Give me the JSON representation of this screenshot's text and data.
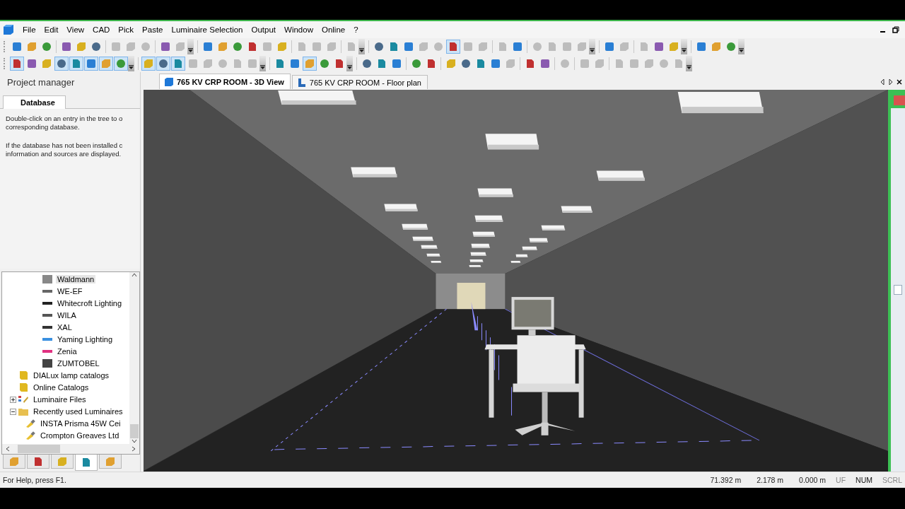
{
  "menu": [
    {
      "label": "File"
    },
    {
      "label": "Edit"
    },
    {
      "label": "View"
    },
    {
      "label": "CAD"
    },
    {
      "label": "Pick"
    },
    {
      "label": "Paste"
    },
    {
      "label": "Luminaire Selection"
    },
    {
      "label": "Output"
    },
    {
      "label": "Window"
    },
    {
      "label": "Online"
    },
    {
      "label": "?"
    }
  ],
  "toolbars": [
    [
      {
        "kind": "button",
        "pressed": false,
        "disabled": false
      },
      {
        "kind": "button",
        "pressed": false,
        "disabled": false
      },
      {
        "kind": "button",
        "pressed": false,
        "disabled": false
      },
      {
        "kind": "separator"
      },
      {
        "kind": "button",
        "pressed": false,
        "disabled": false
      },
      {
        "kind": "button",
        "pressed": false,
        "disabled": false
      },
      {
        "kind": "button",
        "pressed": false,
        "disabled": false
      },
      {
        "kind": "separator"
      },
      {
        "kind": "button",
        "pressed": false,
        "disabled": true
      },
      {
        "kind": "button",
        "pressed": false,
        "disabled": true
      },
      {
        "kind": "button",
        "pressed": false,
        "disabled": true
      },
      {
        "kind": "separator"
      },
      {
        "kind": "button",
        "pressed": false,
        "disabled": false
      },
      {
        "kind": "button",
        "pressed": false,
        "disabled": true
      },
      {
        "kind": "overflow"
      },
      {
        "kind": "separator"
      },
      {
        "kind": "button",
        "pressed": false,
        "disabled": false
      },
      {
        "kind": "button",
        "pressed": false,
        "disabled": false
      },
      {
        "kind": "button",
        "pressed": false,
        "disabled": false
      },
      {
        "kind": "button",
        "pressed": false,
        "disabled": false
      },
      {
        "kind": "button",
        "pressed": false,
        "disabled": true
      },
      {
        "kind": "button",
        "pressed": false,
        "disabled": false
      },
      {
        "kind": "separator"
      },
      {
        "kind": "button",
        "pressed": false,
        "disabled": true
      },
      {
        "kind": "button",
        "pressed": false,
        "disabled": true
      },
      {
        "kind": "button",
        "pressed": false,
        "disabled": true
      },
      {
        "kind": "separator"
      },
      {
        "kind": "button",
        "pressed": false,
        "disabled": true
      },
      {
        "kind": "overflow"
      },
      {
        "kind": "separator"
      },
      {
        "kind": "button",
        "pressed": false,
        "disabled": false
      },
      {
        "kind": "button",
        "pressed": false,
        "disabled": false
      },
      {
        "kind": "button",
        "pressed": false,
        "disabled": false
      },
      {
        "kind": "button",
        "pressed": false,
        "disabled": true
      },
      {
        "kind": "button",
        "pressed": false,
        "disabled": true
      },
      {
        "kind": "button",
        "pressed": true,
        "disabled": false
      },
      {
        "kind": "button",
        "pressed": false,
        "disabled": true
      },
      {
        "kind": "button",
        "pressed": false,
        "disabled": true
      },
      {
        "kind": "separator"
      },
      {
        "kind": "button",
        "pressed": false,
        "disabled": true
      },
      {
        "kind": "button",
        "pressed": false,
        "disabled": false
      },
      {
        "kind": "separator"
      },
      {
        "kind": "button",
        "pressed": false,
        "disabled": true
      },
      {
        "kind": "button",
        "pressed": false,
        "disabled": true
      },
      {
        "kind": "button",
        "pressed": false,
        "disabled": true
      },
      {
        "kind": "button",
        "pressed": false,
        "disabled": true
      },
      {
        "kind": "overflow"
      },
      {
        "kind": "separator"
      },
      {
        "kind": "button",
        "pressed": false,
        "disabled": false
      },
      {
        "kind": "button",
        "pressed": false,
        "disabled": true
      },
      {
        "kind": "separator"
      },
      {
        "kind": "button",
        "pressed": false,
        "disabled": true
      },
      {
        "kind": "button",
        "pressed": false,
        "disabled": false
      },
      {
        "kind": "button",
        "pressed": false,
        "disabled": false
      },
      {
        "kind": "overflow"
      },
      {
        "kind": "separator"
      },
      {
        "kind": "button",
        "pressed": false,
        "disabled": false
      },
      {
        "kind": "button",
        "pressed": false,
        "disabled": false
      },
      {
        "kind": "button",
        "pressed": false,
        "disabled": false
      },
      {
        "kind": "overflow"
      }
    ],
    [
      {
        "kind": "button",
        "pressed": true,
        "disabled": false
      },
      {
        "kind": "button",
        "pressed": false,
        "disabled": false
      },
      {
        "kind": "button",
        "pressed": false,
        "disabled": false
      },
      {
        "kind": "button",
        "pressed": true,
        "disabled": false
      },
      {
        "kind": "button",
        "pressed": true,
        "disabled": false
      },
      {
        "kind": "button",
        "pressed": true,
        "disabled": false
      },
      {
        "kind": "button",
        "pressed": true,
        "disabled": false
      },
      {
        "kind": "button",
        "pressed": true,
        "disabled": false
      },
      {
        "kind": "overflow"
      },
      {
        "kind": "separator"
      },
      {
        "kind": "button",
        "pressed": true,
        "disabled": false
      },
      {
        "kind": "button",
        "pressed": true,
        "disabled": false
      },
      {
        "kind": "button",
        "pressed": true,
        "disabled": false
      },
      {
        "kind": "button",
        "pressed": false,
        "disabled": true
      },
      {
        "kind": "button",
        "pressed": false,
        "disabled": true
      },
      {
        "kind": "button",
        "pressed": false,
        "disabled": true
      },
      {
        "kind": "button",
        "pressed": false,
        "disabled": true
      },
      {
        "kind": "button",
        "pressed": false,
        "disabled": true
      },
      {
        "kind": "overflow"
      },
      {
        "kind": "separator"
      },
      {
        "kind": "button",
        "pressed": false,
        "disabled": false
      },
      {
        "kind": "button",
        "pressed": false,
        "disabled": false
      },
      {
        "kind": "button",
        "pressed": true,
        "disabled": false
      },
      {
        "kind": "button",
        "pressed": false,
        "disabled": false
      },
      {
        "kind": "button",
        "pressed": false,
        "disabled": false
      },
      {
        "kind": "overflow"
      },
      {
        "kind": "separator"
      },
      {
        "kind": "button",
        "pressed": false,
        "disabled": false
      },
      {
        "kind": "button",
        "pressed": false,
        "disabled": false
      },
      {
        "kind": "button",
        "pressed": false,
        "disabled": false
      },
      {
        "kind": "separator"
      },
      {
        "kind": "button",
        "pressed": false,
        "disabled": false
      },
      {
        "kind": "button",
        "pressed": false,
        "disabled": false
      },
      {
        "kind": "separator"
      },
      {
        "kind": "button",
        "pressed": false,
        "disabled": false
      },
      {
        "kind": "button",
        "pressed": false,
        "disabled": false
      },
      {
        "kind": "button",
        "pressed": false,
        "disabled": false
      },
      {
        "kind": "button",
        "pressed": false,
        "disabled": false
      },
      {
        "kind": "button",
        "pressed": false,
        "disabled": true
      },
      {
        "kind": "separator"
      },
      {
        "kind": "button",
        "pressed": false,
        "disabled": false
      },
      {
        "kind": "button",
        "pressed": false,
        "disabled": false
      },
      {
        "kind": "separator"
      },
      {
        "kind": "button",
        "pressed": false,
        "disabled": true
      },
      {
        "kind": "separator"
      },
      {
        "kind": "button",
        "pressed": false,
        "disabled": true
      },
      {
        "kind": "button",
        "pressed": false,
        "disabled": true
      },
      {
        "kind": "separator"
      },
      {
        "kind": "button",
        "pressed": false,
        "disabled": true
      },
      {
        "kind": "button",
        "pressed": false,
        "disabled": true
      },
      {
        "kind": "button",
        "pressed": false,
        "disabled": true
      },
      {
        "kind": "button",
        "pressed": false,
        "disabled": true
      },
      {
        "kind": "button",
        "pressed": false,
        "disabled": true
      },
      {
        "kind": "overflow"
      }
    ]
  ],
  "project_manager": {
    "title": "Project manager",
    "tabs": [
      {
        "label": "Database",
        "selected": true
      }
    ],
    "help_paragraphs": [
      [
        "Double-click on an entry in the tree to o",
        "corresponding database."
      ],
      [
        "If the database has not been installed c",
        "information and sources are displayed."
      ]
    ],
    "tree": {
      "partial_group": [
        {
          "label": "Waldmann",
          "selected": true
        },
        {
          "label": "WE-EF",
          "selected": false
        },
        {
          "label": "Whitecroft Lighting",
          "selected": false
        },
        {
          "label": "WILA",
          "selected": false
        },
        {
          "label": "XAL",
          "selected": false
        },
        {
          "label": "Yaming Lighting",
          "selected": false
        },
        {
          "label": "Zenia",
          "selected": false
        },
        {
          "label": "ZUMTOBEL",
          "selected": false
        }
      ],
      "items": [
        {
          "label": "DIALux lamp catalogs",
          "kind": "book",
          "selected": false
        },
        {
          "label": "Online Catalogs",
          "kind": "book",
          "selected": false
        },
        {
          "label": "Luminaire Files",
          "kind": "files",
          "selected": false,
          "expanded": false
        },
        {
          "label": "Recently used Luminaires",
          "kind": "folder",
          "selected": false,
          "expanded": true,
          "children": [
            {
              "label": "INSTA Prisma 45W Cei",
              "kind": "luminaire",
              "selected": false
            },
            {
              "label": "Crompton Greaves Ltd",
              "kind": "luminaire",
              "selected": false
            }
          ]
        }
      ]
    },
    "bottom_tabs": [
      {
        "selected": false
      },
      {
        "selected": false
      },
      {
        "selected": false
      },
      {
        "selected": true
      },
      {
        "selected": false
      }
    ]
  },
  "document_tabs": [
    {
      "label": "765 KV CRP ROOM - 3D View",
      "kind": "perspective",
      "selected": true
    },
    {
      "label": "765 KV CRP ROOM - Floor plan",
      "kind": "plan",
      "selected": false
    }
  ],
  "status_bar": {
    "help": "For Help, press F1.",
    "coordinates": [
      "71.392 m",
      "2.178 m",
      "0.000 m"
    ],
    "indicators": [
      {
        "label": "UF",
        "on": false
      },
      {
        "label": "NUM",
        "on": true
      },
      {
        "label": "SCRL",
        "on": false
      }
    ]
  }
}
